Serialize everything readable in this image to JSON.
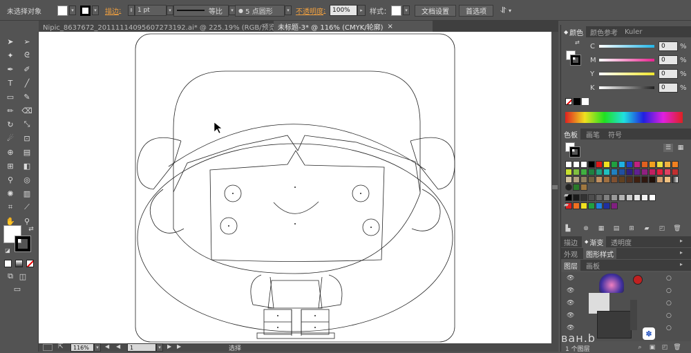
{
  "control_bar": {
    "selection_label": "未选择对象",
    "stroke_link": "描边",
    "stroke_weight": "1 pt",
    "stroke_profile": "等比",
    "brush": "5 点圆形",
    "opacity_link": "不透明度",
    "opacity_value": "100%",
    "style_label": "样式：",
    "doc_setup_button": "文档设置",
    "prefs_button": "首选项",
    "stroke_color": "#000000",
    "fill_color": "#ffffff",
    "accent_link_color": "#f0a040"
  },
  "doc_tabs": [
    {
      "title": "Nipic_8637672_20111114095607273192.ai* @ 225.19% (RGB/预览)",
      "close": "×",
      "active": false
    },
    {
      "title": "未标题-3* @ 116% (CMYK/轮廓)",
      "close": "×",
      "active": true
    }
  ],
  "status_bar": {
    "zoom": "116%",
    "page": "1",
    "tool_name": "选择"
  },
  "color_panel": {
    "tabs": [
      "颜色",
      "颜色参考",
      "Kuler"
    ],
    "channels": [
      {
        "label": "C",
        "value": "0",
        "unit": "%",
        "color": "#23b6e8"
      },
      {
        "label": "M",
        "value": "0",
        "unit": "%",
        "color": "#e8238f"
      },
      {
        "label": "Y",
        "value": "0",
        "unit": "%",
        "color": "#f0e62e"
      },
      {
        "label": "K",
        "value": "0",
        "unit": "%",
        "color": "#222222"
      }
    ]
  },
  "swatches_panel": {
    "tabs": [
      "色板",
      "画笔",
      "符号"
    ]
  },
  "stroke_panel": {
    "tabs": [
      "描边",
      "渐变",
      "透明度"
    ]
  },
  "appearance_panel": {
    "tabs": [
      "外观",
      "图形样式"
    ]
  },
  "layers_panel": {
    "tabs": [
      "图层",
      "画板"
    ],
    "footer": "1 个图层"
  },
  "watermark": {
    "text": "ван.b"
  }
}
